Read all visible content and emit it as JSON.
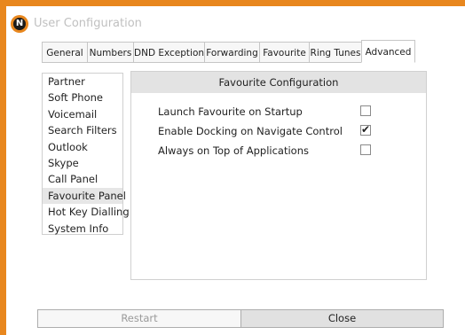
{
  "window": {
    "title": "User Configuration",
    "icon": "nectar-logo",
    "accent_color": "#e8871e"
  },
  "tabs": [
    {
      "label": "General"
    },
    {
      "label": "Numbers"
    },
    {
      "label": "DND Exception"
    },
    {
      "label": "Forwarding"
    },
    {
      "label": "Favourite"
    },
    {
      "label": "Ring Tunes"
    },
    {
      "label": "Advanced",
      "active": true
    }
  ],
  "sidebar": {
    "items": [
      {
        "label": "Partner"
      },
      {
        "label": "Soft Phone"
      },
      {
        "label": "Voicemail"
      },
      {
        "label": "Search Filters"
      },
      {
        "label": "Outlook"
      },
      {
        "label": "Skype"
      },
      {
        "label": "Call Panel"
      },
      {
        "label": "Favourite Panel",
        "selected": true
      },
      {
        "label": "Hot Key Dialling"
      },
      {
        "label": "System Info"
      }
    ]
  },
  "panel": {
    "title": "Favourite Configuration",
    "options": [
      {
        "label": "Launch Favourite on Startup",
        "checked": false
      },
      {
        "label": "Enable Docking on Navigate Control",
        "checked": true,
        "check_glyph": "✔"
      },
      {
        "label": "Always on Top of Applications",
        "checked": false
      }
    ]
  },
  "footer": {
    "restart_label": "Restart",
    "close_label": "Close"
  }
}
